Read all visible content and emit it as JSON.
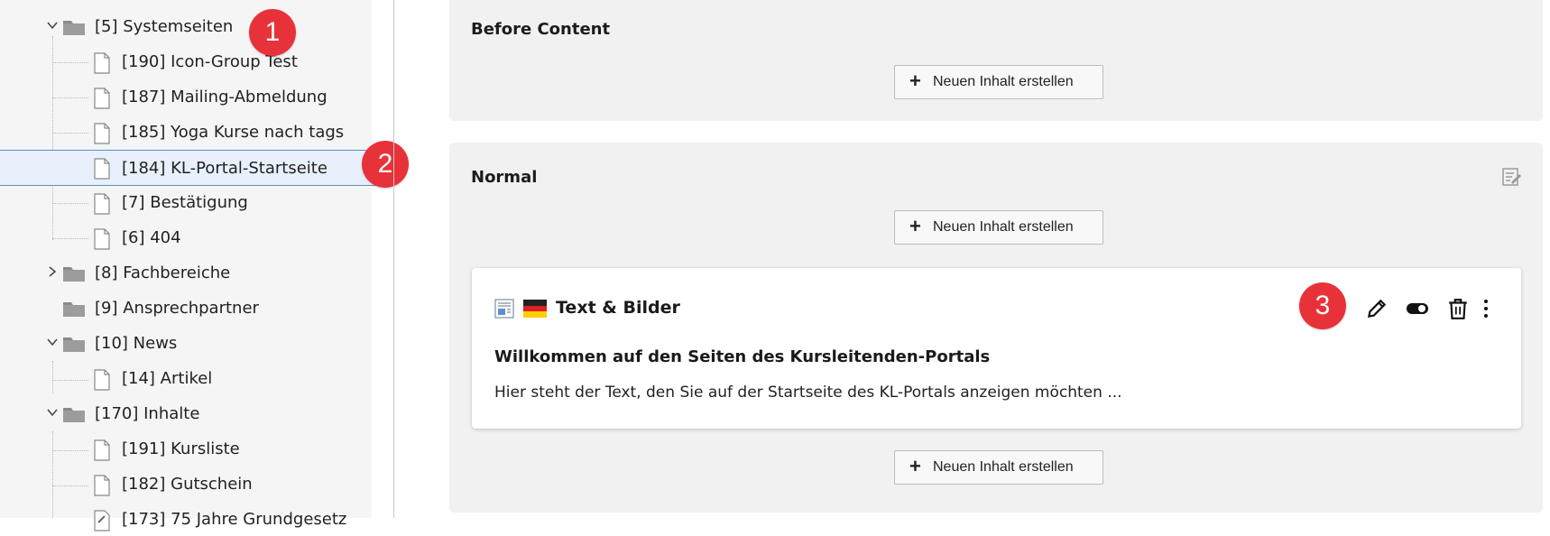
{
  "tree": {
    "items": [
      {
        "label": "[5] Systemseiten",
        "icon": "folder-icon",
        "expanded": true
      },
      {
        "label": "[190] Icon-Group Test",
        "icon": "page-icon"
      },
      {
        "label": "[187] Mailing-Abmeldung",
        "icon": "page-icon"
      },
      {
        "label": "[185] Yoga Kurse nach tags",
        "icon": "page-icon"
      },
      {
        "label": "[184] KL-Portal-Startseite",
        "icon": "page-icon",
        "selected": true
      },
      {
        "label": "[7] Bestätigung",
        "icon": "page-icon"
      },
      {
        "label": "[6] 404",
        "icon": "page-icon"
      },
      {
        "label": "[8] Fachbereiche",
        "icon": "folder-icon",
        "expanded": false
      },
      {
        "label": "[9] Ansprechpartner",
        "icon": "folder-icon"
      },
      {
        "label": "[10] News",
        "icon": "folder-icon",
        "expanded": true
      },
      {
        "label": "[14] Artikel",
        "icon": "page-icon"
      },
      {
        "label": "[170] Inhalte",
        "icon": "folder-icon",
        "expanded": true
      },
      {
        "label": "[191] Kursliste",
        "icon": "page-icon"
      },
      {
        "label": "[182] Gutschein",
        "icon": "page-icon"
      },
      {
        "label": "[173] 75 Jahre Grundgesetz",
        "icon": "link-page-icon"
      }
    ]
  },
  "badges": {
    "one": "1",
    "two": "2",
    "three": "3"
  },
  "content": {
    "before_content": {
      "title": "Before Content",
      "new_button": "Neuen Inhalt erstellen"
    },
    "normal": {
      "title": "Normal",
      "new_button_top": "Neuen Inhalt erstellen",
      "new_button_bottom": "Neuen Inhalt erstellen"
    },
    "element": {
      "type_label": "Text & Bilder",
      "language_flag": "de-flag-icon",
      "headline": "Willkommen auf den Seiten des Kursleitenden-Portals",
      "body": "Hier steht der Text, den Sie auf der Startseite des KL-Portals anzeigen möchten ..."
    }
  },
  "colors": {
    "badge": "#e8323a",
    "selection": "#e8f1fb",
    "panel": "#f1f1f1"
  }
}
